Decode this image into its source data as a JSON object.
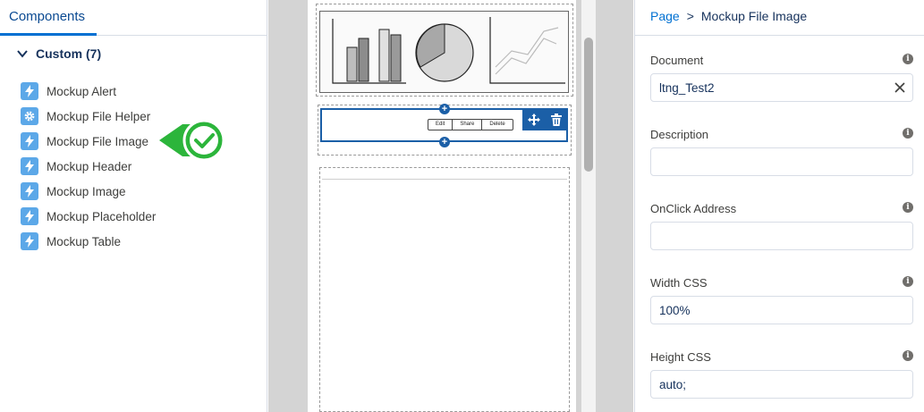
{
  "left_panel": {
    "tab_label": "Components",
    "section_label": "Custom (7)",
    "items": [
      {
        "label": "Mockup Alert",
        "icon": "lightning-icon"
      },
      {
        "label": "Mockup File Helper",
        "icon": "gear-icon"
      },
      {
        "label": "Mockup File Image",
        "icon": "lightning-icon"
      },
      {
        "label": "Mockup Header",
        "icon": "lightning-icon"
      },
      {
        "label": "Mockup Image",
        "icon": "lightning-icon"
      },
      {
        "label": "Mockup Placeholder",
        "icon": "lightning-icon"
      },
      {
        "label": "Mockup Table",
        "icon": "lightning-icon"
      }
    ]
  },
  "canvas": {
    "buttons": [
      "Edit",
      "Share",
      "Delete"
    ]
  },
  "right_panel": {
    "breadcrumb": {
      "root": "Page",
      "separator": ">",
      "current": "Mockup File Image"
    },
    "fields": [
      {
        "label": "Document",
        "value": "ltng_Test2"
      },
      {
        "label": "Description",
        "value": ""
      },
      {
        "label": "OnClick Address",
        "value": ""
      },
      {
        "label": "Width CSS",
        "value": "100%"
      },
      {
        "label": "Height CSS",
        "value": "auto;"
      }
    ]
  },
  "colors": {
    "accent": "#0070d2",
    "selection": "#1b5fa7",
    "success": "#2cb53b",
    "component_icon": "#5ca8e8"
  }
}
